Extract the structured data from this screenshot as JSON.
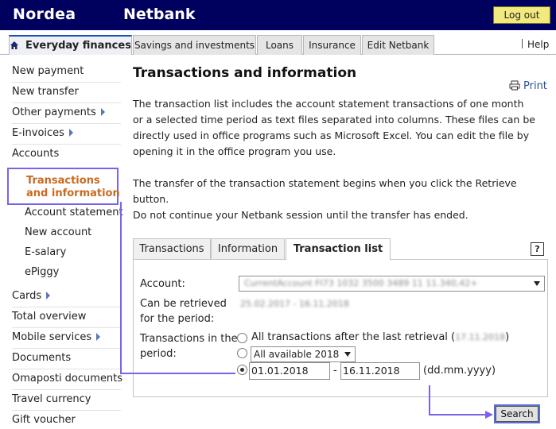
{
  "header": {
    "logo": "Nordea",
    "app_name": "Netbank",
    "logout_label": "Log out"
  },
  "nav": {
    "tabs": [
      "Everyday finances",
      "Savings and investments",
      "Loans",
      "Insurance",
      "Edit Netbank"
    ],
    "help_label": "Help"
  },
  "sidebar": {
    "items": [
      {
        "label": "New payment"
      },
      {
        "label": "New transfer"
      },
      {
        "label": "Other payments"
      },
      {
        "label": "E-invoices"
      },
      {
        "label": "Accounts"
      }
    ],
    "active_item": "Transactions and information",
    "sub_items": [
      {
        "label": "Account statement"
      },
      {
        "label": "New account"
      },
      {
        "label": "E-salary"
      },
      {
        "label": "ePiggy"
      }
    ],
    "items_after": [
      {
        "label": "Cards"
      },
      {
        "label": "Total overview"
      },
      {
        "label": "Mobile services"
      },
      {
        "label": "Documents"
      },
      {
        "label": "Omaposti documents"
      },
      {
        "label": "Travel currency"
      },
      {
        "label": "Gift voucher"
      }
    ]
  },
  "main": {
    "title": "Transactions and information",
    "print_label": "Print",
    "paragraph1_lines": [
      "The transaction list includes the account statement transactions of one month",
      "or a selected time period as text files separated into columns. These files can be",
      "directly used in office programs such as Microsoft Excel. You can edit the file by",
      "opening it in the office program you use."
    ],
    "paragraph2_lines": [
      "The transfer of the transaction statement begins when you click the Retrieve button.",
      "Do not continue your Netbank session until the transfer has ended."
    ]
  },
  "panel": {
    "tabs": [
      "Transactions",
      "Information",
      "Transaction list"
    ],
    "help_icon": "?",
    "account_label": "Account:",
    "account_value": "CurrentAccount   FI73 1032 3500 3489 11   11.340,42+",
    "retrievable_label_1": "Can be retrieved",
    "retrievable_label_2": "for the period:",
    "retrievable_value": "25.02.2017 - 16.11.2018",
    "period_label_1": "Transactions in the",
    "period_label_2": "period:",
    "option_all_after": "All transactions after the last retrieval (",
    "option_all_after_date": "17.11.2018",
    "option_all_after_close": ")",
    "year_select": "All available 2018",
    "date_from": "01.01.2018",
    "date_sep": "-",
    "date_to": "16.11.2018",
    "date_format": "(dd.mm.yyyy)",
    "search_label": "Search"
  }
}
